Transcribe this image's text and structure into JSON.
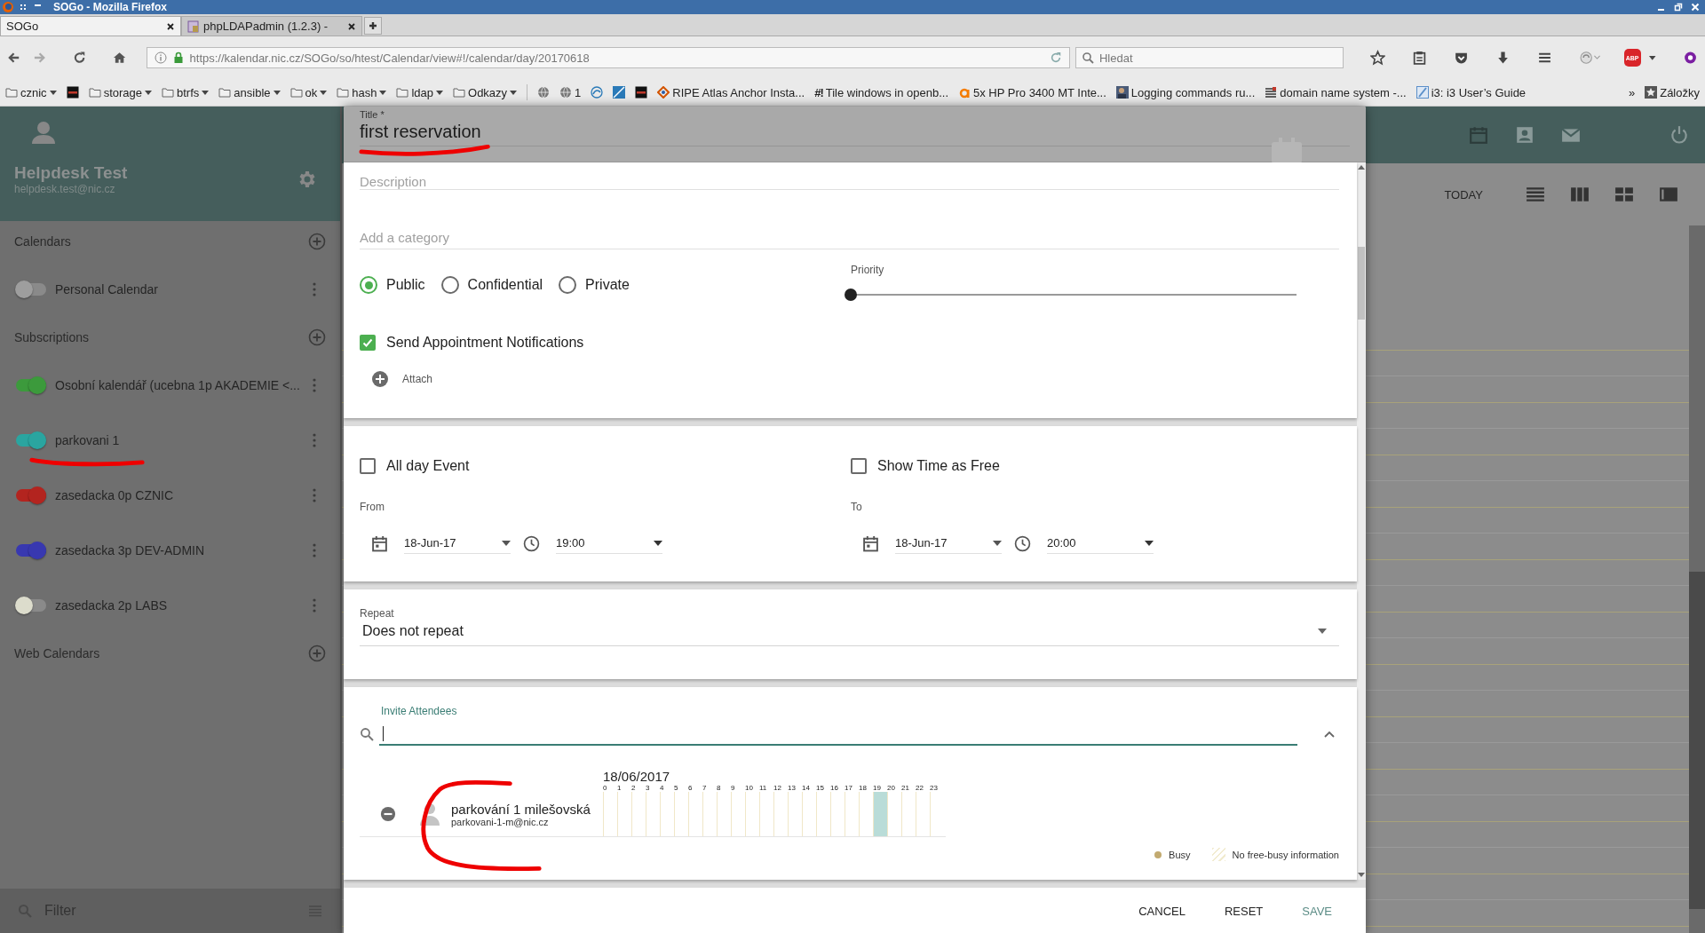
{
  "window": {
    "title": "SOGo - Mozilla Firefox"
  },
  "tabs": [
    {
      "label": "SOGo",
      "selected": true,
      "kind": "plain"
    },
    {
      "label": "phpLDAPadmin (1.2.3) -",
      "selected": false,
      "kind": "pla"
    }
  ],
  "address_bar": {
    "url": "https://kalendar.nic.cz/SOGo/so/htest/Calendar/view#!/calendar/day/20170618"
  },
  "search_bar": {
    "placeholder": "Hledat"
  },
  "toolbar": {
    "abp_label": "ABP"
  },
  "bookmarks": [
    {
      "kind": "folder",
      "label": "cznic"
    },
    {
      "kind": "site"
    },
    {
      "kind": "folder",
      "label": "storage"
    },
    {
      "kind": "folder",
      "label": "btrfs"
    },
    {
      "kind": "folder",
      "label": "ansible"
    },
    {
      "kind": "folder",
      "label": "ok"
    },
    {
      "kind": "folder",
      "label": "hash"
    },
    {
      "kind": "folder",
      "label": "ldap"
    },
    {
      "kind": "folder",
      "label": "Odkazy"
    },
    {
      "kind": "site"
    },
    {
      "kind": "site",
      "label": "1"
    },
    {
      "kind": "site"
    },
    {
      "kind": "site"
    },
    {
      "kind": "site"
    },
    {
      "kind": "site",
      "label": "RIPE Atlas Anchor Insta..."
    },
    {
      "kind": "site",
      "glyph": "#!",
      "label": "Tile windows in openb..."
    },
    {
      "kind": "site",
      "label": "5x HP Pro 3400 MT Inte..."
    },
    {
      "kind": "site",
      "label": "Logging commands ru..."
    },
    {
      "kind": "site",
      "label": "domain name system -..."
    },
    {
      "kind": "site",
      "label": "i3: i3 User’s Guide"
    }
  ],
  "bookmarks_overflow": "»",
  "bookmarks_menu": "Záložky",
  "sidebar": {
    "user_name": "Helpdesk Test",
    "user_email": "helpdesk.test@nic.cz",
    "sections": [
      {
        "title": "Calendars",
        "items": [
          {
            "name": "Personal Calendar",
            "on": false,
            "color": "#9e9e9e"
          }
        ]
      },
      {
        "title": "Subscriptions",
        "items": [
          {
            "name": "Osobní kalendář (ucebna 1p AKADEMIE <...",
            "on": true,
            "color": "#3c9a3c"
          },
          {
            "name": "parkovani 1",
            "on": true,
            "color": "#2aa5a0"
          },
          {
            "name": "zasedacka 0p CZNIC",
            "on": true,
            "color": "#b3241f"
          },
          {
            "name": "zasedacka 3p DEV-ADMIN",
            "on": true,
            "color": "#3838b0"
          },
          {
            "name": "zasedacka 2p LABS",
            "on": false,
            "color": "#dcdccc"
          }
        ]
      },
      {
        "title": "Web Calendars"
      }
    ],
    "filter": {
      "placeholder": "Filter"
    }
  },
  "calendar_view": {
    "today_button": "TODAY"
  },
  "dialog": {
    "title_label": "Title *",
    "title_value": "first reservation",
    "description_placeholder": "Description",
    "category_placeholder": "Add a category",
    "classification": [
      {
        "label": "Public",
        "selected": true
      },
      {
        "label": "Confidential",
        "selected": false
      },
      {
        "label": "Private",
        "selected": false
      }
    ],
    "priority": {
      "label": "Priority",
      "level": 0
    },
    "send_notifications": {
      "label": "Send Appointment Notifications",
      "checked": true
    },
    "attach_label": "Attach",
    "all_day": {
      "label": "All day Event",
      "checked": false
    },
    "show_free": {
      "label": "Show Time as Free",
      "checked": false
    },
    "from": {
      "label": "From",
      "date": "18-Jun-17",
      "time": "19:00"
    },
    "to": {
      "label": "To",
      "date": "18-Jun-17",
      "time": "20:00"
    },
    "repeat": {
      "label": "Repeat",
      "value": "Does not repeat"
    },
    "attendees": {
      "label": "Invite Attendees",
      "date": "18/06/2017",
      "hours": [
        {
          "label": "0",
          "selected": false
        },
        {
          "label": "1",
          "selected": false
        },
        {
          "label": "2",
          "selected": false
        },
        {
          "label": "3",
          "selected": false
        },
        {
          "label": "4",
          "selected": false
        },
        {
          "label": "5",
          "selected": false
        },
        {
          "label": "6",
          "selected": false
        },
        {
          "label": "7",
          "selected": false
        },
        {
          "label": "8",
          "selected": false
        },
        {
          "label": "9",
          "selected": false
        },
        {
          "label": "10",
          "selected": false
        },
        {
          "label": "11",
          "selected": false
        },
        {
          "label": "12",
          "selected": false
        },
        {
          "label": "13",
          "selected": false
        },
        {
          "label": "14",
          "selected": false
        },
        {
          "label": "15",
          "selected": false
        },
        {
          "label": "16",
          "selected": false
        },
        {
          "label": "17",
          "selected": false
        },
        {
          "label": "18",
          "selected": false
        },
        {
          "label": "19",
          "selected": true
        },
        {
          "label": "20",
          "selected": false
        },
        {
          "label": "21",
          "selected": false
        },
        {
          "label": "22",
          "selected": false
        },
        {
          "label": "23",
          "selected": false
        }
      ],
      "list": [
        {
          "name": "parkování 1 milešovská",
          "email": "parkovani-1-m@nic.cz"
        }
      ]
    },
    "legend": [
      {
        "label": "Busy",
        "kind": "busy"
      },
      {
        "label": "No free-busy information",
        "kind": "unknown"
      }
    ],
    "buttons": [
      {
        "label": "CANCEL",
        "kind": "plain"
      },
      {
        "label": "RESET",
        "kind": "plain"
      },
      {
        "label": "SAVE",
        "kind": "primary"
      }
    ]
  }
}
